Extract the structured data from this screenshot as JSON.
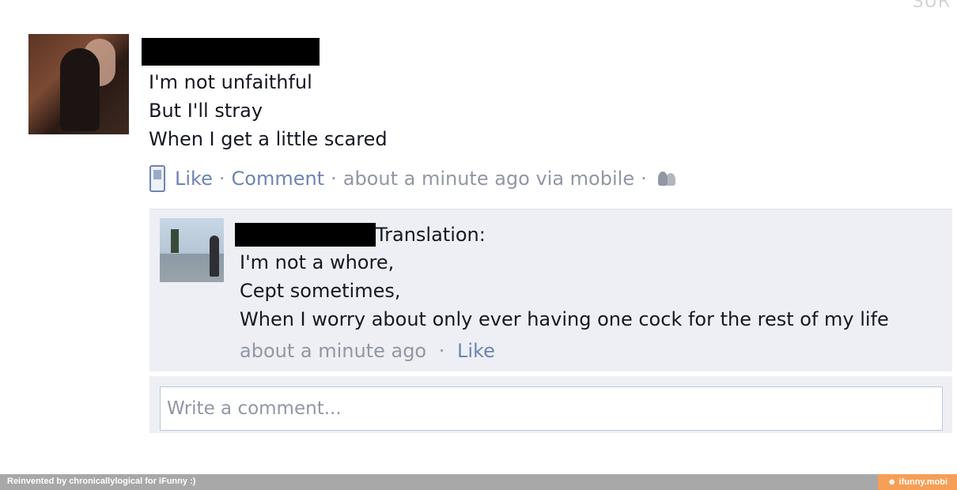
{
  "post": {
    "lines": [
      "I'm not unfaithful",
      "But I'll stray",
      "When I get a little scared"
    ],
    "actions": {
      "like": "Like",
      "comment": "Comment",
      "timestamp": "about a minute ago via mobile",
      "separator": "·"
    }
  },
  "comment": {
    "lead": "Translation:",
    "lines": [
      "I'm not a whore,",
      "Cept sometimes,",
      "When I worry about only ever having one cock for the rest of my life"
    ],
    "timestamp": "about a minute ago",
    "like": "Like",
    "separator": "·"
  },
  "write_comment": {
    "placeholder": "Write a comment..."
  },
  "footer": {
    "credit": "Reinvented by chronicallylogical for iFunny :)",
    "site": "☻ ifunny.mobi"
  },
  "header_fragment": "SUR",
  "colors": {
    "link": "#6d84b4",
    "meta": "#9197a3",
    "comment_bg": "#edeff4",
    "footer_bg": "#a8a8a8",
    "footer_badge": "#f59f57"
  },
  "icons": {
    "phone": "mobile-phone-icon",
    "audience": "friends-icon"
  }
}
